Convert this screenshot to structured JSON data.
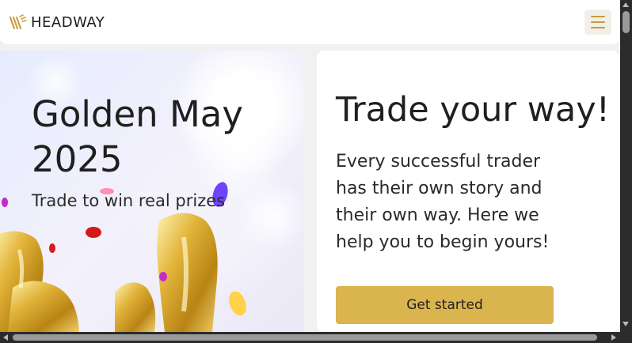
{
  "header": {
    "logo_text": "HEADWAY",
    "menu_icon": "hamburger-menu-icon"
  },
  "promo": {
    "title": "Golden May 2025",
    "subtitle": "Trade to win real prizes"
  },
  "card": {
    "title": "Trade your way!",
    "text": "Every successful trader has their own story and their own way. Here we help you to begin yours!",
    "cta_label": "Get started"
  },
  "colors": {
    "accent": "#d9b44f",
    "logo_gold": "#c79a3e",
    "text": "#1f1f1f"
  }
}
